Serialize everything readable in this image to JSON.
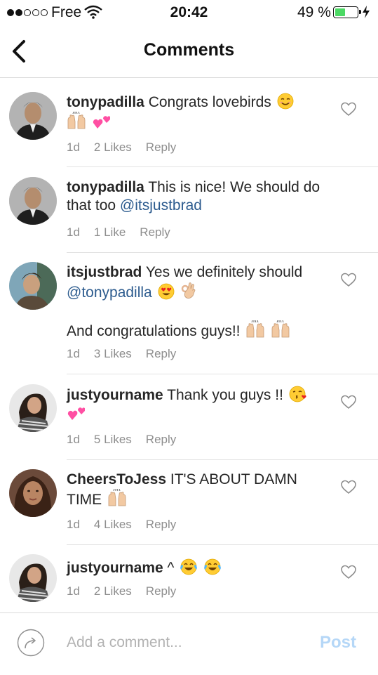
{
  "status_bar": {
    "carrier": "Free",
    "time": "20:42",
    "battery_percent": "49 %",
    "battery_level": 0.49,
    "signal_bars_filled": 2,
    "signal_bars_total": 5
  },
  "header": {
    "title": "Comments",
    "back_icon": "chevron-left-icon"
  },
  "comments": [
    {
      "username": "tonypadilla",
      "text": "Congrats lovebirds",
      "emojis": [
        "smiling-face",
        "raising-hands",
        "two-hearts"
      ],
      "time": "1d",
      "likes": "2 Likes",
      "reply": "Reply",
      "liked": false
    },
    {
      "username": "tonypadilla",
      "text": "This is nice! We should do that too",
      "mention": "@itsjustbrad",
      "time": "1d",
      "likes": "1 Like",
      "reply": "Reply"
    },
    {
      "username": "itsjustbrad",
      "text": "Yes we definitely should",
      "mention": "@tonypadilla",
      "emojis": [
        "heart-eyes",
        "ok-hand"
      ],
      "text2": "And congratulations guys!!",
      "emojis2": [
        "raising-hands",
        "raising-hands"
      ],
      "time": "1d",
      "likes": "3 Likes",
      "reply": "Reply",
      "liked": false
    },
    {
      "username": "justyourname",
      "text": "Thank you guys !!",
      "emojis": [
        "face-blowing-kiss",
        "two-hearts"
      ],
      "time": "1d",
      "likes": "5 Likes",
      "reply": "Reply",
      "liked": false
    },
    {
      "username": "CheersToJess",
      "text": "IT'S ABOUT DAMN TIME",
      "emojis": [
        "raising-hands"
      ],
      "time": "1d",
      "likes": "4 Likes",
      "reply": "Reply",
      "liked": false
    },
    {
      "username": "justyourname",
      "text": "^",
      "emojis": [
        "tears-of-joy",
        "tears-of-joy"
      ],
      "time": "1d",
      "likes": "2 Likes",
      "reply": "Reply",
      "liked": false
    }
  ],
  "composer": {
    "placeholder": "Add a comment...",
    "post_label": "Post",
    "share_icon": "share-arrow-icon"
  },
  "colors": {
    "mention": "#2c5b8e",
    "meta_text": "#8e8e8e",
    "post_disabled": "#b5d7f7",
    "battery_fill": "#4cd964"
  }
}
